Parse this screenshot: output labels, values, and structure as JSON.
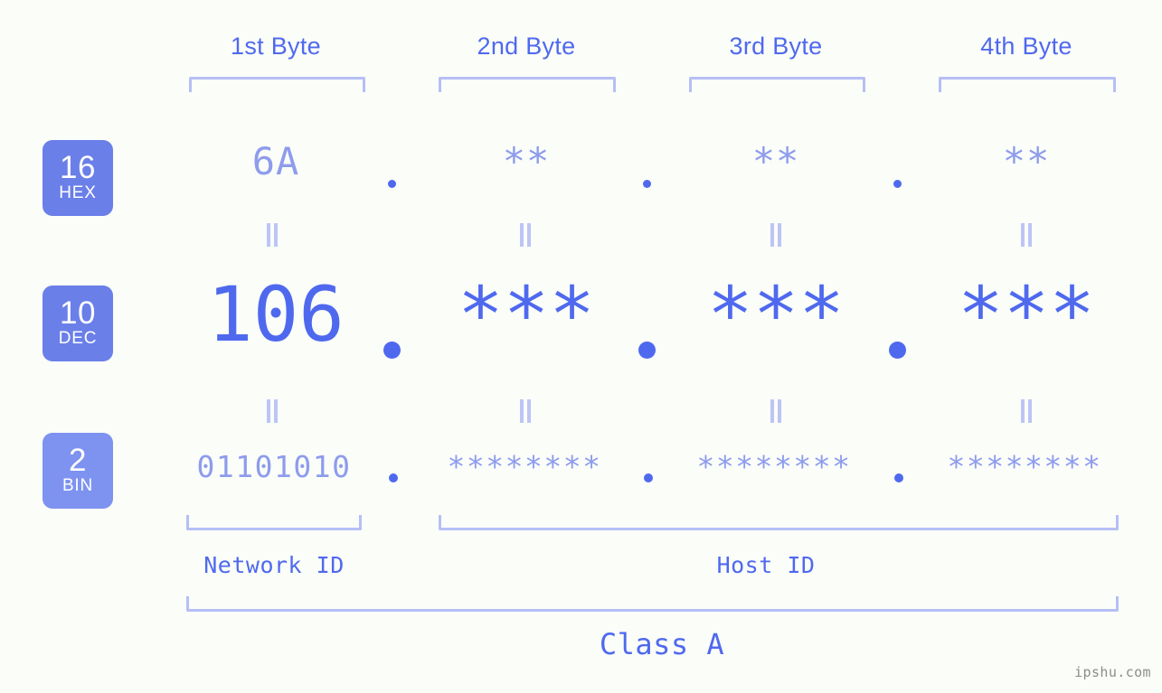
{
  "meta": {
    "background_color": "#FBFDF9",
    "accent_strong": "#4F69EE",
    "accent_muted": "#8E9CEC",
    "bracket_color": "#B6BFF5",
    "badge_color": "#6A7FE8",
    "badge_color_light": "#7E92F0"
  },
  "header": {
    "byte_labels": [
      {
        "label": "1st Byte"
      },
      {
        "label": "2nd Byte"
      },
      {
        "label": "3rd Byte"
      },
      {
        "label": "4th Byte"
      }
    ]
  },
  "rows": [
    {
      "id": "hex",
      "badge_number": "16",
      "badge_name": "HEX",
      "badge_color": "#6A7FE8",
      "values": [
        "6A",
        "**",
        "**",
        "**"
      ],
      "separator": "."
    },
    {
      "id": "dec",
      "badge_number": "10",
      "badge_name": "DEC",
      "badge_color": "#6A7FE8",
      "values": [
        "106",
        "***",
        "***",
        "***"
      ],
      "separator": "."
    },
    {
      "id": "bin",
      "badge_number": "2",
      "badge_name": "BIN",
      "badge_color": "#7E92F0",
      "values": [
        "01101010",
        "********",
        "********",
        "********"
      ],
      "separator": "."
    }
  ],
  "equality_marks": {
    "symbol": "=",
    "count_per_row": 4,
    "rows": 2
  },
  "footer": {
    "network_id_label": "Network ID",
    "host_id_label": "Host ID",
    "class_label": "Class A"
  },
  "watermark": {
    "text": "ipshu.com"
  }
}
